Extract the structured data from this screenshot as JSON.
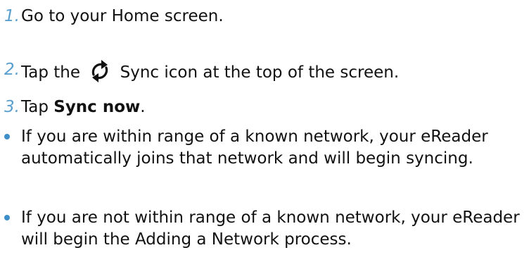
{
  "steps": [
    {
      "number": "1.",
      "text": "Go to your Home screen."
    },
    {
      "number": "2.",
      "text_before": "Tap the",
      "icon": "sync-icon",
      "text_after": "Sync icon at the top of the screen."
    },
    {
      "number": "3.",
      "text_before": "Tap ",
      "bold": "Sync now",
      "text_after": "."
    }
  ],
  "bullets": [
    {
      "text": "If you are within range of a known network, your eReader automatically joins that network and will begin syncing."
    },
    {
      "text": "If you are not within range of a known network, your eReader will begin the Adding a Network process."
    }
  ],
  "colors": {
    "accent": "#5AA0CF",
    "bullet": "#3C8FC8",
    "text": "#111111"
  }
}
